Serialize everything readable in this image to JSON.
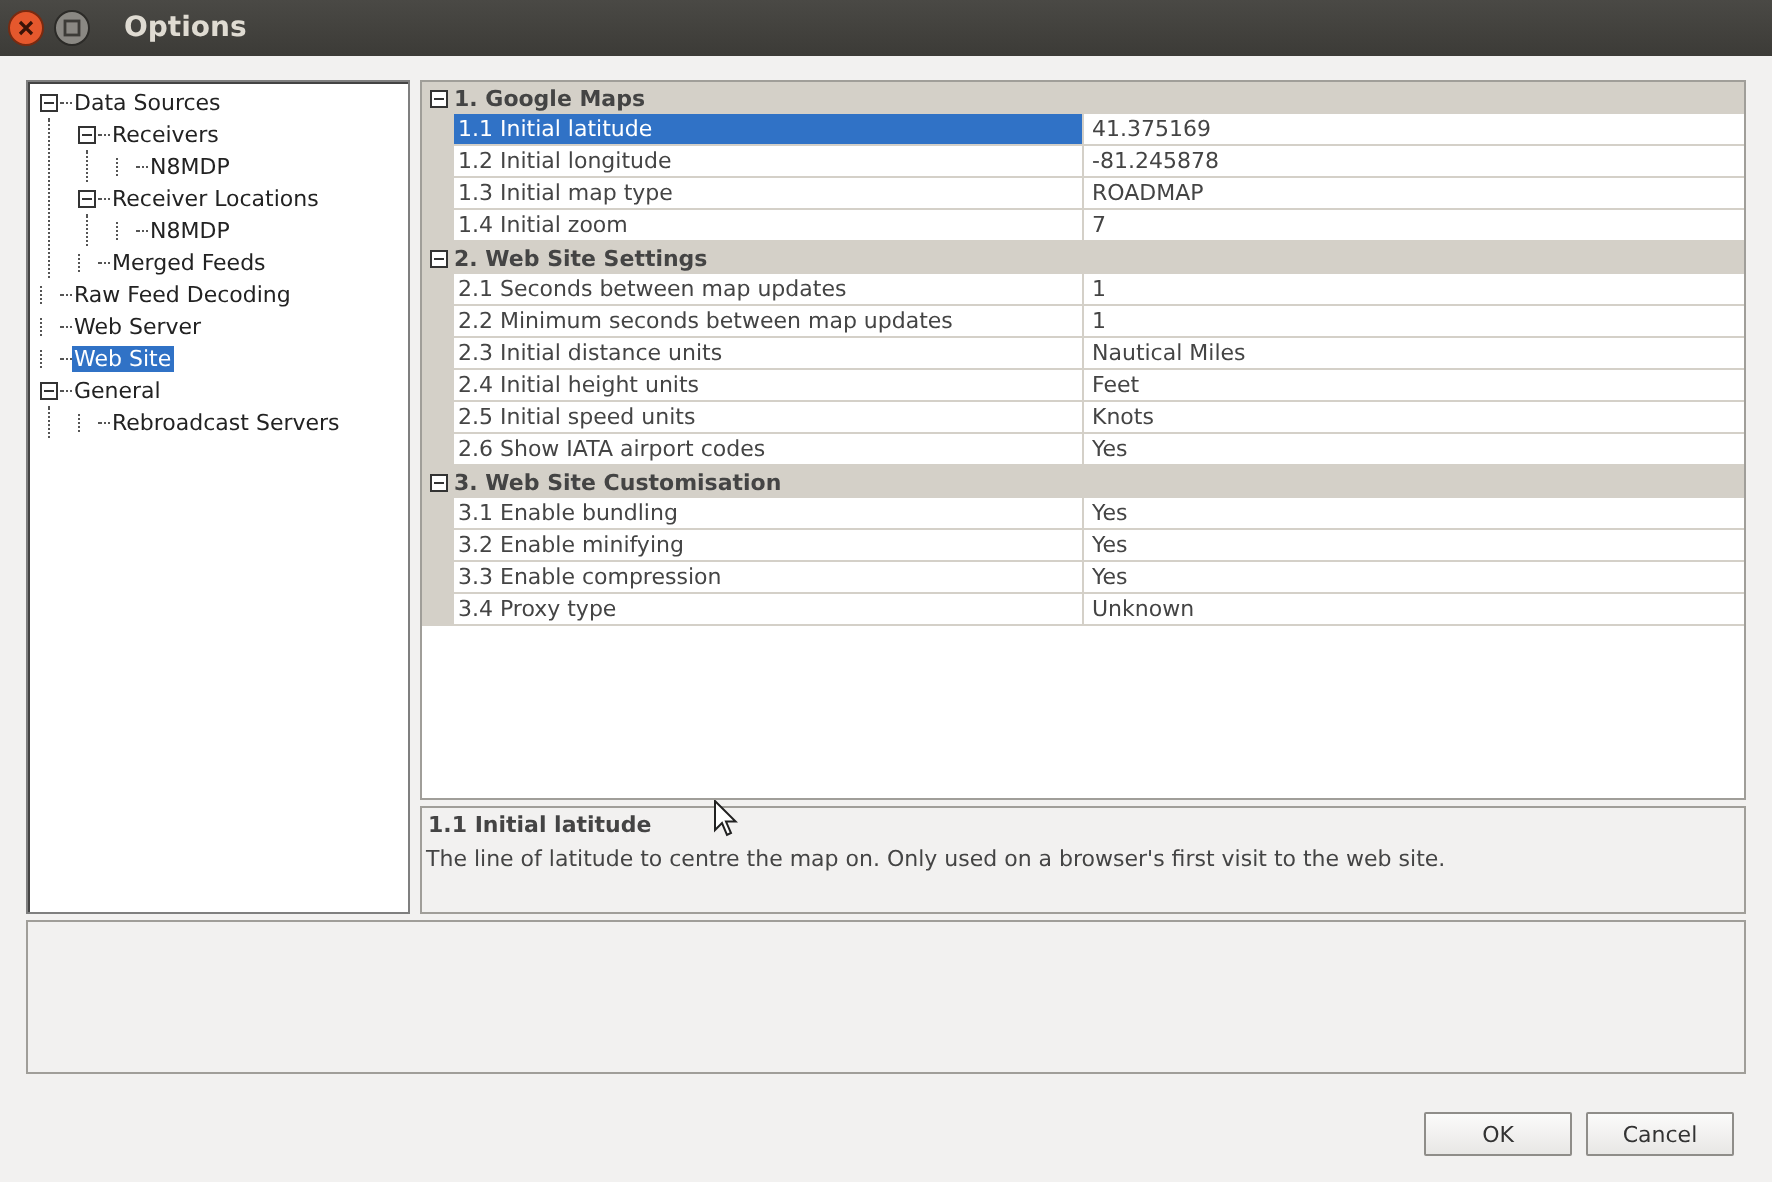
{
  "window": {
    "title": "Options"
  },
  "tree": [
    {
      "label": "Data Sources",
      "expanded": true,
      "selected": false,
      "children": [
        {
          "label": "Receivers",
          "expanded": true,
          "selected": false,
          "children": [
            {
              "label": "N8MDP",
              "selected": false
            }
          ]
        },
        {
          "label": "Receiver Locations",
          "expanded": true,
          "selected": false,
          "children": [
            {
              "label": "N8MDP",
              "selected": false
            }
          ]
        },
        {
          "label": "Merged Feeds",
          "selected": false
        }
      ]
    },
    {
      "label": "Raw Feed Decoding",
      "selected": false
    },
    {
      "label": "Web Server",
      "selected": false
    },
    {
      "label": "Web Site",
      "selected": true
    },
    {
      "label": "General",
      "expanded": true,
      "selected": false,
      "children": [
        {
          "label": "Rebroadcast Servers",
          "selected": false
        }
      ]
    }
  ],
  "grid": {
    "categories": [
      {
        "title": "1. Google Maps",
        "expanded": true,
        "rows": [
          {
            "name": "1.1 Initial latitude",
            "value": "41.375169",
            "selected": true
          },
          {
            "name": "1.2 Initial longitude",
            "value": "-81.245878",
            "selected": false
          },
          {
            "name": "1.3 Initial map type",
            "value": "ROADMAP",
            "selected": false
          },
          {
            "name": "1.4 Initial zoom",
            "value": "7",
            "selected": false
          }
        ]
      },
      {
        "title": "2. Web Site Settings",
        "expanded": true,
        "rows": [
          {
            "name": "2.1 Seconds between map updates",
            "value": "1",
            "selected": false
          },
          {
            "name": "2.2 Minimum seconds between map updates",
            "value": "1",
            "selected": false
          },
          {
            "name": "2.3 Initial distance units",
            "value": "Nautical Miles",
            "selected": false
          },
          {
            "name": "2.4 Initial height units",
            "value": "Feet",
            "selected": false
          },
          {
            "name": "2.5 Initial speed units",
            "value": "Knots",
            "selected": false
          },
          {
            "name": "2.6 Show IATA airport codes",
            "value": "Yes",
            "selected": false
          }
        ]
      },
      {
        "title": "3. Web Site Customisation",
        "expanded": true,
        "rows": [
          {
            "name": "3.1 Enable bundling",
            "value": "Yes",
            "selected": false
          },
          {
            "name": "3.2 Enable minifying",
            "value": "Yes",
            "selected": false
          },
          {
            "name": "3.3 Enable compression",
            "value": "Yes",
            "selected": false
          },
          {
            "name": "3.4 Proxy type",
            "value": "Unknown",
            "selected": false
          }
        ]
      }
    ]
  },
  "description": {
    "title": "1.1 Initial latitude",
    "text": "The line of latitude to centre the map on. Only used on a browser's first visit to the web site."
  },
  "buttons": [
    "OK",
    "Cancel"
  ]
}
